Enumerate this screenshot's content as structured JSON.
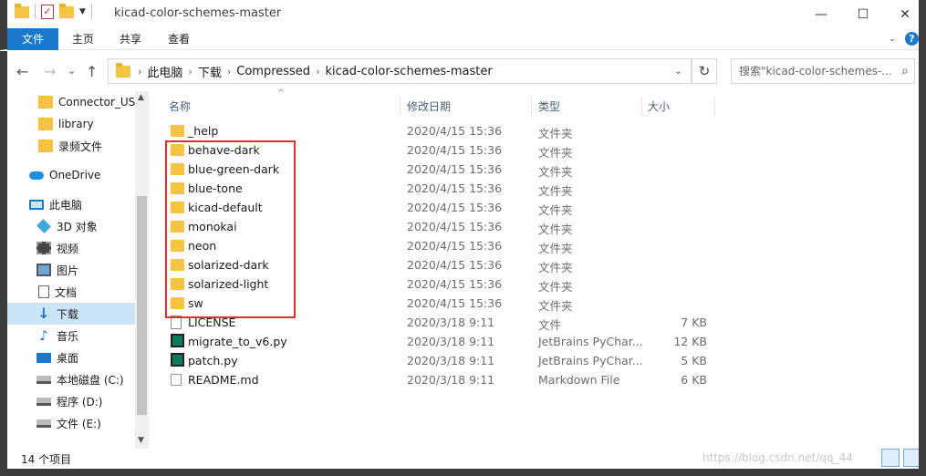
{
  "window": {
    "title": "kicad-color-schemes-master",
    "minimize": "—",
    "maximize": "☐",
    "close": "✕"
  },
  "ribbon": {
    "tabs": [
      "文件",
      "主页",
      "共享",
      "查看"
    ]
  },
  "address": {
    "back": "←",
    "forward": "→",
    "recent": "⌄",
    "up": "↑",
    "crumbs": [
      "此电脑",
      "下载",
      "Compressed",
      "kicad-color-schemes-master"
    ],
    "search_placeholder": "搜索\"kicad-color-schemes-...",
    "refresh": "↻"
  },
  "sidebar": {
    "items": [
      {
        "label": "Connector_USB",
        "icon": "folder-icon"
      },
      {
        "label": "library",
        "icon": "folder-icon"
      },
      {
        "label": "录频文件",
        "icon": "folder-icon"
      },
      {
        "label": "OneDrive",
        "icon": "cloud-icon"
      },
      {
        "label": "此电脑",
        "icon": "computer-icon"
      },
      {
        "label": "3D 对象",
        "icon": "3d-objects-icon"
      },
      {
        "label": "视频",
        "icon": "video-icon"
      },
      {
        "label": "图片",
        "icon": "pictures-icon"
      },
      {
        "label": "文档",
        "icon": "documents-icon"
      },
      {
        "label": "下载",
        "icon": "download-icon",
        "active": true
      },
      {
        "label": "音乐",
        "icon": "music-icon"
      },
      {
        "label": "桌面",
        "icon": "desktop-icon"
      },
      {
        "label": "本地磁盘 (C:)",
        "icon": "drive-icon"
      },
      {
        "label": "程序 (D:)",
        "icon": "drive-icon"
      },
      {
        "label": "文件 (E:)",
        "icon": "drive-icon"
      }
    ]
  },
  "columns": {
    "name": "名称",
    "date": "修改日期",
    "type": "类型",
    "size": "大小"
  },
  "files": [
    {
      "name": "_help",
      "date": "2020/4/15 15:36",
      "type": "文件夹",
      "size": "",
      "icon": "folder-icon"
    },
    {
      "name": "behave-dark",
      "date": "2020/4/15 15:36",
      "type": "文件夹",
      "size": "",
      "icon": "folder-icon"
    },
    {
      "name": "blue-green-dark",
      "date": "2020/4/15 15:36",
      "type": "文件夹",
      "size": "",
      "icon": "folder-icon"
    },
    {
      "name": "blue-tone",
      "date": "2020/4/15 15:36",
      "type": "文件夹",
      "size": "",
      "icon": "folder-icon"
    },
    {
      "name": "kicad-default",
      "date": "2020/4/15 15:36",
      "type": "文件夹",
      "size": "",
      "icon": "folder-icon"
    },
    {
      "name": "monokai",
      "date": "2020/4/15 15:36",
      "type": "文件夹",
      "size": "",
      "icon": "folder-icon"
    },
    {
      "name": "neon",
      "date": "2020/4/15 15:36",
      "type": "文件夹",
      "size": "",
      "icon": "folder-icon"
    },
    {
      "name": "solarized-dark",
      "date": "2020/4/15 15:36",
      "type": "文件夹",
      "size": "",
      "icon": "folder-icon"
    },
    {
      "name": "solarized-light",
      "date": "2020/4/15 15:36",
      "type": "文件夹",
      "size": "",
      "icon": "folder-icon"
    },
    {
      "name": "sw",
      "date": "2020/4/15 15:36",
      "type": "文件夹",
      "size": "",
      "icon": "folder-icon"
    },
    {
      "name": "LICENSE",
      "date": "2020/3/18 9:11",
      "type": "文件",
      "size": "7 KB",
      "icon": "file-icon"
    },
    {
      "name": "migrate_to_v6.py",
      "date": "2020/3/18 9:11",
      "type": "JetBrains PyChar...",
      "size": "12 KB",
      "icon": "pycharm-icon"
    },
    {
      "name": "patch.py",
      "date": "2020/3/18 9:11",
      "type": "JetBrains PyChar...",
      "size": "5 KB",
      "icon": "pycharm-icon"
    },
    {
      "name": "README.md",
      "date": "2020/3/18 9:11",
      "type": "Markdown File",
      "size": "6 KB",
      "icon": "markdown-icon"
    }
  ],
  "status": {
    "count": "14 个项目",
    "watermark": "https://blog.csdn.net/qq_44"
  },
  "colors": {
    "accent": "#1979ca",
    "highlight_box": "#e03131",
    "folder": "#f5c542"
  }
}
